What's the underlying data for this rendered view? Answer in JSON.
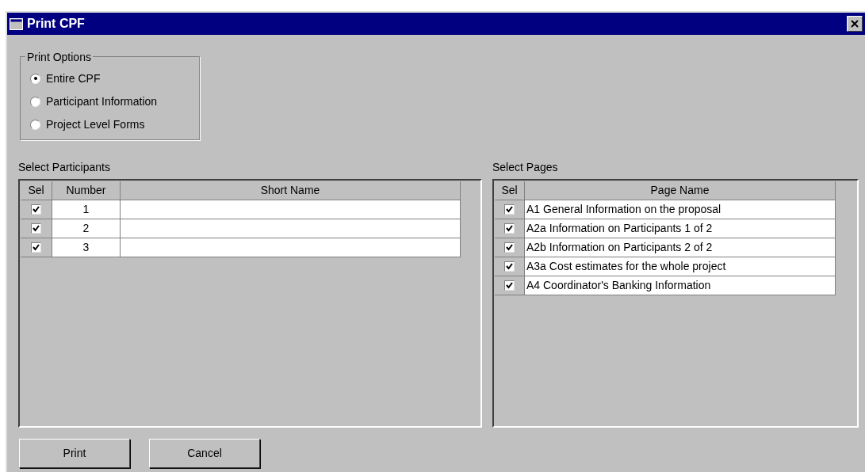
{
  "window": {
    "title": "Print CPF"
  },
  "print_options": {
    "title": "Print Options",
    "options": [
      {
        "label": "Entire CPF",
        "selected": true
      },
      {
        "label": "Participant Information",
        "selected": false
      },
      {
        "label": "Project Level Forms",
        "selected": false
      }
    ]
  },
  "participants": {
    "label": "Select Participants",
    "columns": [
      "Sel",
      "Number",
      "Short Name"
    ],
    "rows": [
      {
        "checked": true,
        "number": "1"
      },
      {
        "checked": true,
        "number": "2"
      },
      {
        "checked": true,
        "number": "3"
      }
    ]
  },
  "pages": {
    "label": "Select Pages",
    "columns": [
      "Sel",
      "Page Name"
    ],
    "rows": [
      {
        "checked": true,
        "name": "A1 General Information on the proposal"
      },
      {
        "checked": true,
        "name": "A2a Information on Participants 1 of 2"
      },
      {
        "checked": true,
        "name": "A2b Information on Participants 2 of 2"
      },
      {
        "checked": true,
        "name": "A3a Cost estimates for the whole project"
      },
      {
        "checked": true,
        "name": "A4 Coordinator's Banking Information"
      }
    ]
  },
  "buttons": [
    "Print",
    "Cancel"
  ]
}
